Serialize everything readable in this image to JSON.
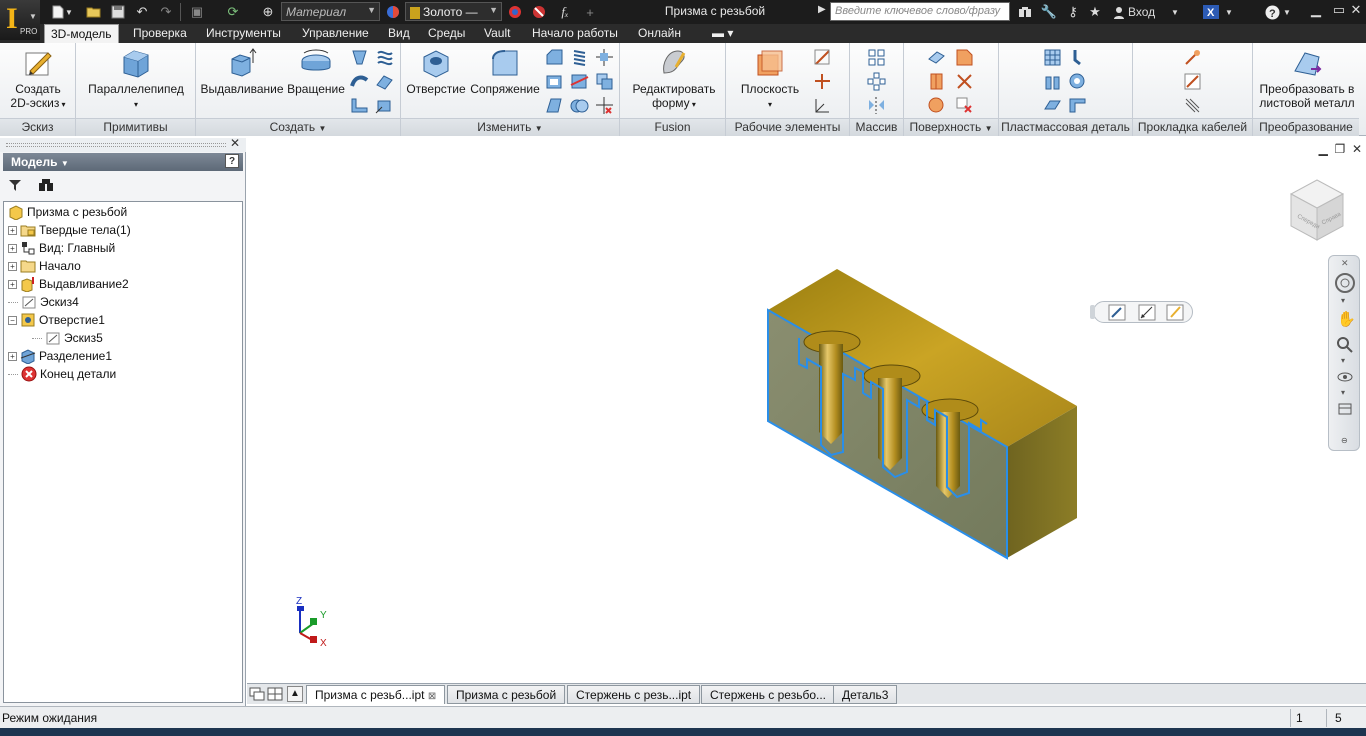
{
  "titlebar": {
    "material_placeholder": "Материал",
    "appearance_value": "Золото —",
    "document_title": "Призма с резьбой",
    "search_placeholder": "Введите ключевое слово/фразу",
    "sign_in": "Вход"
  },
  "app": {
    "edition": "PRO"
  },
  "tabs": [
    {
      "label": "3D-модель"
    },
    {
      "label": "Проверка"
    },
    {
      "label": "Инструменты"
    },
    {
      "label": "Управление"
    },
    {
      "label": "Вид"
    },
    {
      "label": "Среды"
    },
    {
      "label": "Vault"
    },
    {
      "label": "Начало работы"
    },
    {
      "label": "Онлайн"
    }
  ],
  "ribbon": {
    "sketch": {
      "title": "Эскиз",
      "create_2d_line1": "Создать",
      "create_2d_line2": "2D-эскиз"
    },
    "primitives": {
      "title": "Примитивы",
      "box": "Параллелепипед"
    },
    "create": {
      "title": "Создать",
      "extrude": "Выдавливание",
      "revolve": "Вращение"
    },
    "modify": {
      "title": "Изменить",
      "hole": "Отверстие",
      "fillet": "Сопряжение"
    },
    "fusion": {
      "title": "Fusion",
      "edit_form_line1": "Редактировать",
      "edit_form_line2": "форму"
    },
    "work_features": {
      "title": "Рабочие элементы",
      "plane": "Плоскость"
    },
    "pattern": {
      "title": "Массив"
    },
    "surface": {
      "title": "Поверхность"
    },
    "plastic": {
      "title": "Пластмассовая деталь"
    },
    "harness": {
      "title": "Прокладка кабелей"
    },
    "convert": {
      "title": "Преобразование",
      "convert_line1": "Преобразовать в",
      "convert_line2": "листовой металл"
    }
  },
  "browser": {
    "header": "Модель",
    "help": "?",
    "tree": [
      {
        "label": "Призма с резьбой"
      },
      {
        "label": "Твердые тела(1)"
      },
      {
        "label": "Вид: Главный"
      },
      {
        "label": "Начало"
      },
      {
        "label": "Выдавливание2"
      },
      {
        "label": "Эскиз4"
      },
      {
        "label": "Отверстие1"
      },
      {
        "label": "Эскиз5"
      },
      {
        "label": "Разделение1"
      },
      {
        "label": "Конец детали"
      }
    ]
  },
  "viewport": {
    "axis_x": "X",
    "axis_y": "Y",
    "axis_z": "Z",
    "viewcube_faces": {
      "front": "Спереди",
      "right": "Справа"
    }
  },
  "document_tabs": [
    {
      "label": "Призма с резьб...ipt"
    },
    {
      "label": "Призма с резьбой"
    },
    {
      "label": "Стержень с резь...ipt"
    },
    {
      "label": "Стержень с резьбо..."
    },
    {
      "label": "Деталь3"
    }
  ],
  "status": {
    "text": "Режим ожидания",
    "count_a": "1",
    "count_b": "5"
  },
  "colors": {
    "titlebar": "#1c1c1c",
    "part_top": "#c9a21d",
    "part_side": "#7f7a2c",
    "section_face": "#7d8369",
    "section_edge": "#2a8ee8"
  }
}
